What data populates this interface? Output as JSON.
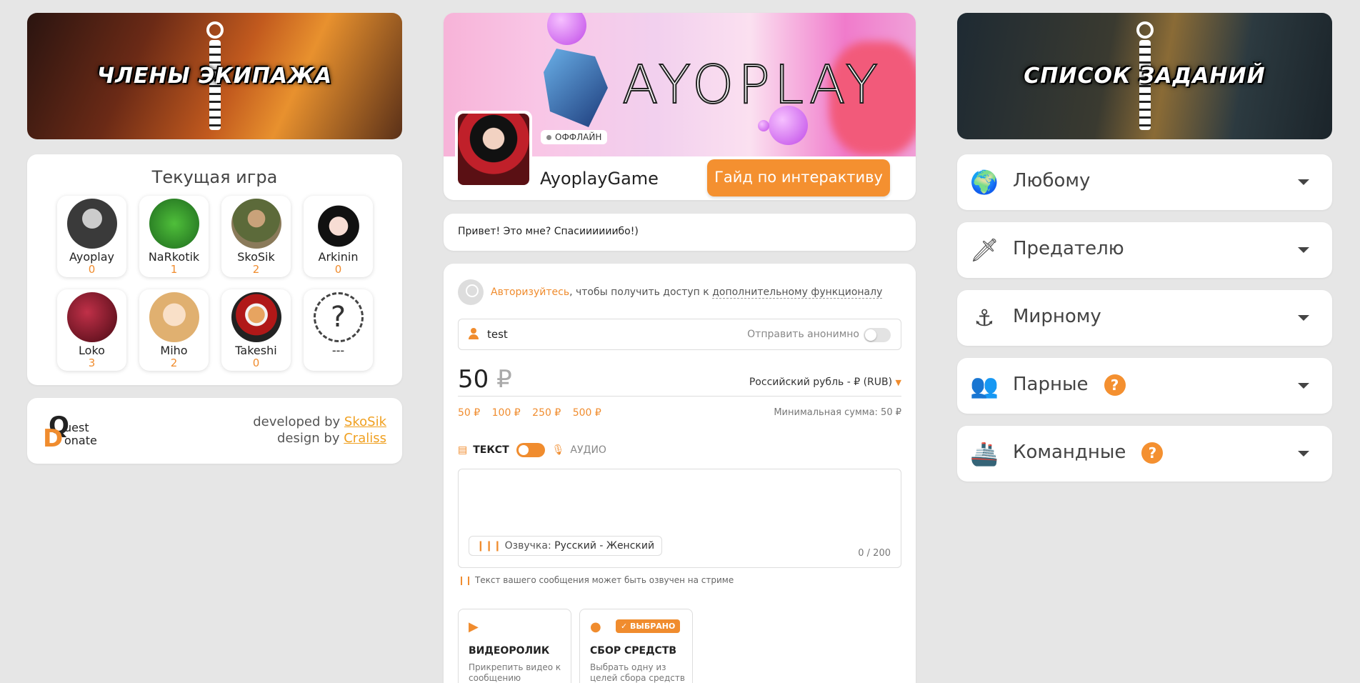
{
  "left": {
    "banner_title": "ЧЛЕНЫ ЭКИПАЖА",
    "game_title": "Текущая игра",
    "players": [
      {
        "name": "Ayoplay",
        "score": "0",
        "color": "#3a3a3a"
      },
      {
        "name": "NaRkotik",
        "score": "1",
        "color": "#2e8b2e"
      },
      {
        "name": "SkoSik",
        "score": "2",
        "color": "#6b6b3a"
      },
      {
        "name": "Arkinin",
        "score": "0",
        "color": "#f5e6e6"
      },
      {
        "name": "Loko",
        "score": "3",
        "color": "#8a1a2a"
      },
      {
        "name": "Miho",
        "score": "2",
        "color": "#f0c8a8"
      },
      {
        "name": "Takeshi",
        "score": "0",
        "color": "#3a2a2a"
      },
      {
        "name": "---",
        "score": "",
        "unknown_symbol": "?"
      }
    ],
    "dev": {
      "logo_q": "Q",
      "logo_d": "D",
      "logo_line1": "uest",
      "logo_line2": "onate",
      "developed_prefix": "developed by",
      "developed_name": "SkoSik",
      "design_prefix": "design by",
      "design_name": "Craliss"
    }
  },
  "middle": {
    "banner_text": "AYOPLAY",
    "status": "ОФФЛАЙН",
    "profile_name": "AyoplayGame",
    "guide_button": "Гайд по интерактиву",
    "message": "Привет! Это мне? Спасиииииибо!)",
    "auth": {
      "link": "Авторизуйтесь",
      "text_prefix": ", чтобы получить доступ к ",
      "text_under": "дополнительному функционалу"
    },
    "name_field_value": "test",
    "anon_label": "Отправить анонимно",
    "amount": "50",
    "amount_currency": "₽",
    "currency_select": "Российский рубль - ₽ (RUB)",
    "presets": [
      "50 ₽",
      "100 ₽",
      "250 ₽",
      "500 ₽"
    ],
    "min_sum": "Минимальная сумма: 50 ₽",
    "mode_text": "ТЕКСТ",
    "mode_audio": "АУДИО",
    "voice_label": "Озвучка:",
    "voice_value": "Русский - Женский",
    "counter": "0 / 200",
    "hint": "Текст вашего сообщения может быть озвучен на стриме",
    "options": [
      {
        "title": "ВИДЕОРОЛИК",
        "desc": "Прикрепить видео к сообщению"
      },
      {
        "title": "СБОР СРЕДСТВ",
        "desc": "Выбрать одну из целей сбора средств",
        "badge": "ВЫБРАНО"
      }
    ]
  },
  "right": {
    "banner_title": "СПИСОК ЗАДАНИЙ",
    "categories": [
      {
        "label": "Любому",
        "icon": "globe-icon"
      },
      {
        "label": "Предателю",
        "icon": "knife-icon"
      },
      {
        "label": "Мирному",
        "icon": "anchor-icon"
      },
      {
        "label": "Парные",
        "icon": "pair-icon",
        "help": "?"
      },
      {
        "label": "Командные",
        "icon": "ship-icon",
        "help": "?"
      }
    ]
  },
  "colors": {
    "accent": "#f08c2e",
    "background": "#e6e6e6"
  }
}
